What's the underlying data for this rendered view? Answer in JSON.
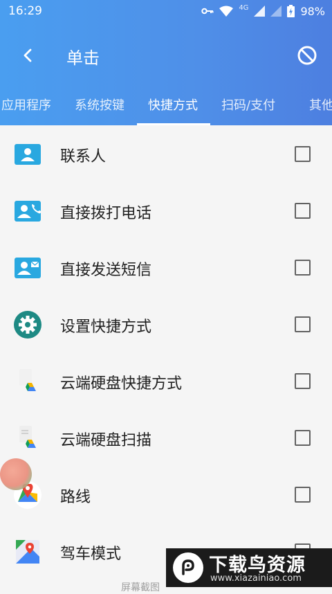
{
  "status_bar": {
    "time": "16:29",
    "network_badge": "4G",
    "battery_percent": "98%"
  },
  "app_bar": {
    "title": "单击"
  },
  "tabs": [
    {
      "label": "应用程序",
      "active": false
    },
    {
      "label": "系统按键",
      "active": false
    },
    {
      "label": "快捷方式",
      "active": true
    },
    {
      "label": "扫码/支付",
      "active": false
    },
    {
      "label": "其他",
      "active": false
    }
  ],
  "items": [
    {
      "label": "联系人",
      "icon": "contact-card-icon",
      "checked": false
    },
    {
      "label": "直接拨打电话",
      "icon": "contact-call-icon",
      "checked": false
    },
    {
      "label": "直接发送短信",
      "icon": "contact-message-icon",
      "checked": false
    },
    {
      "label": "设置快捷方式",
      "icon": "settings-gear-icon",
      "checked": false
    },
    {
      "label": "云端硬盘快捷方式",
      "icon": "google-drive-file-icon",
      "checked": false
    },
    {
      "label": "云端硬盘扫描",
      "icon": "google-drive-scan-icon",
      "checked": false
    },
    {
      "label": "路线",
      "icon": "google-maps-icon",
      "checked": false
    },
    {
      "label": "驾车模式",
      "icon": "maps-drive-icon",
      "checked": false
    }
  ],
  "watermark": {
    "title": "下载鸟资源",
    "url": "www.xiazainiao.com"
  },
  "bottom_caption": "屏幕截图"
}
